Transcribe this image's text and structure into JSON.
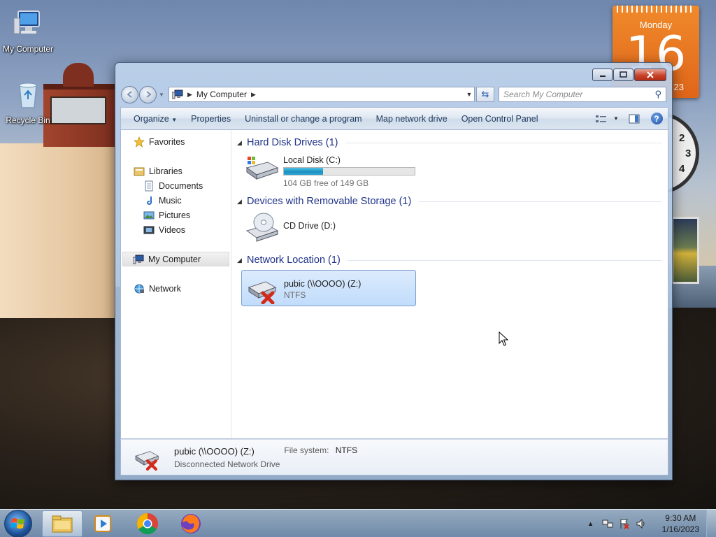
{
  "desktop": {
    "icons": [
      {
        "label": "My Computer",
        "icon": "computer-icon"
      },
      {
        "label": "Recycle Bin",
        "icon": "recycle-bin-icon"
      }
    ],
    "calendar": {
      "weekday": "Monday",
      "day": "16",
      "year_fragment": "23"
    },
    "clock_numbers": [
      "2",
      "3",
      "4"
    ]
  },
  "window": {
    "address": {
      "location": "My Computer"
    },
    "search": {
      "placeholder": "Search My Computer"
    },
    "toolbar": {
      "organize": "Organize",
      "properties": "Properties",
      "uninstall": "Uninstall or change a program",
      "map_drive": "Map network drive",
      "control_panel": "Open Control Panel"
    },
    "nav": {
      "favorites": "Favorites",
      "libraries": "Libraries",
      "documents": "Documents",
      "music": "Music",
      "pictures": "Pictures",
      "videos": "Videos",
      "my_computer": "My Computer",
      "network": "Network"
    },
    "groups": {
      "hdd": {
        "title": "Hard Disk Drives (1)",
        "drive": {
          "name": "Local Disk (C:)",
          "free": "104 GB free of 149 GB",
          "used_fraction": 0.3
        }
      },
      "removable": {
        "title": "Devices with Removable Storage (1)",
        "drive": {
          "name": "CD Drive (D:)"
        }
      },
      "network": {
        "title": "Network Location (1)",
        "drive": {
          "name": "pubic (\\\\OOOO) (Z:)",
          "fs": "NTFS"
        }
      }
    },
    "details": {
      "name": "pubic (\\\\OOOO) (Z:)",
      "status": "Disconnected Network Drive",
      "fs_label": "File system:",
      "fs_value": "NTFS"
    }
  },
  "taskbar": {
    "time": "9:30 AM",
    "date": "1/16/2023"
  },
  "colors": {
    "group_title": "#1e3287",
    "selection": "#c1dcfc",
    "close_button": "#c8442b",
    "calendar": "#e0651a"
  }
}
